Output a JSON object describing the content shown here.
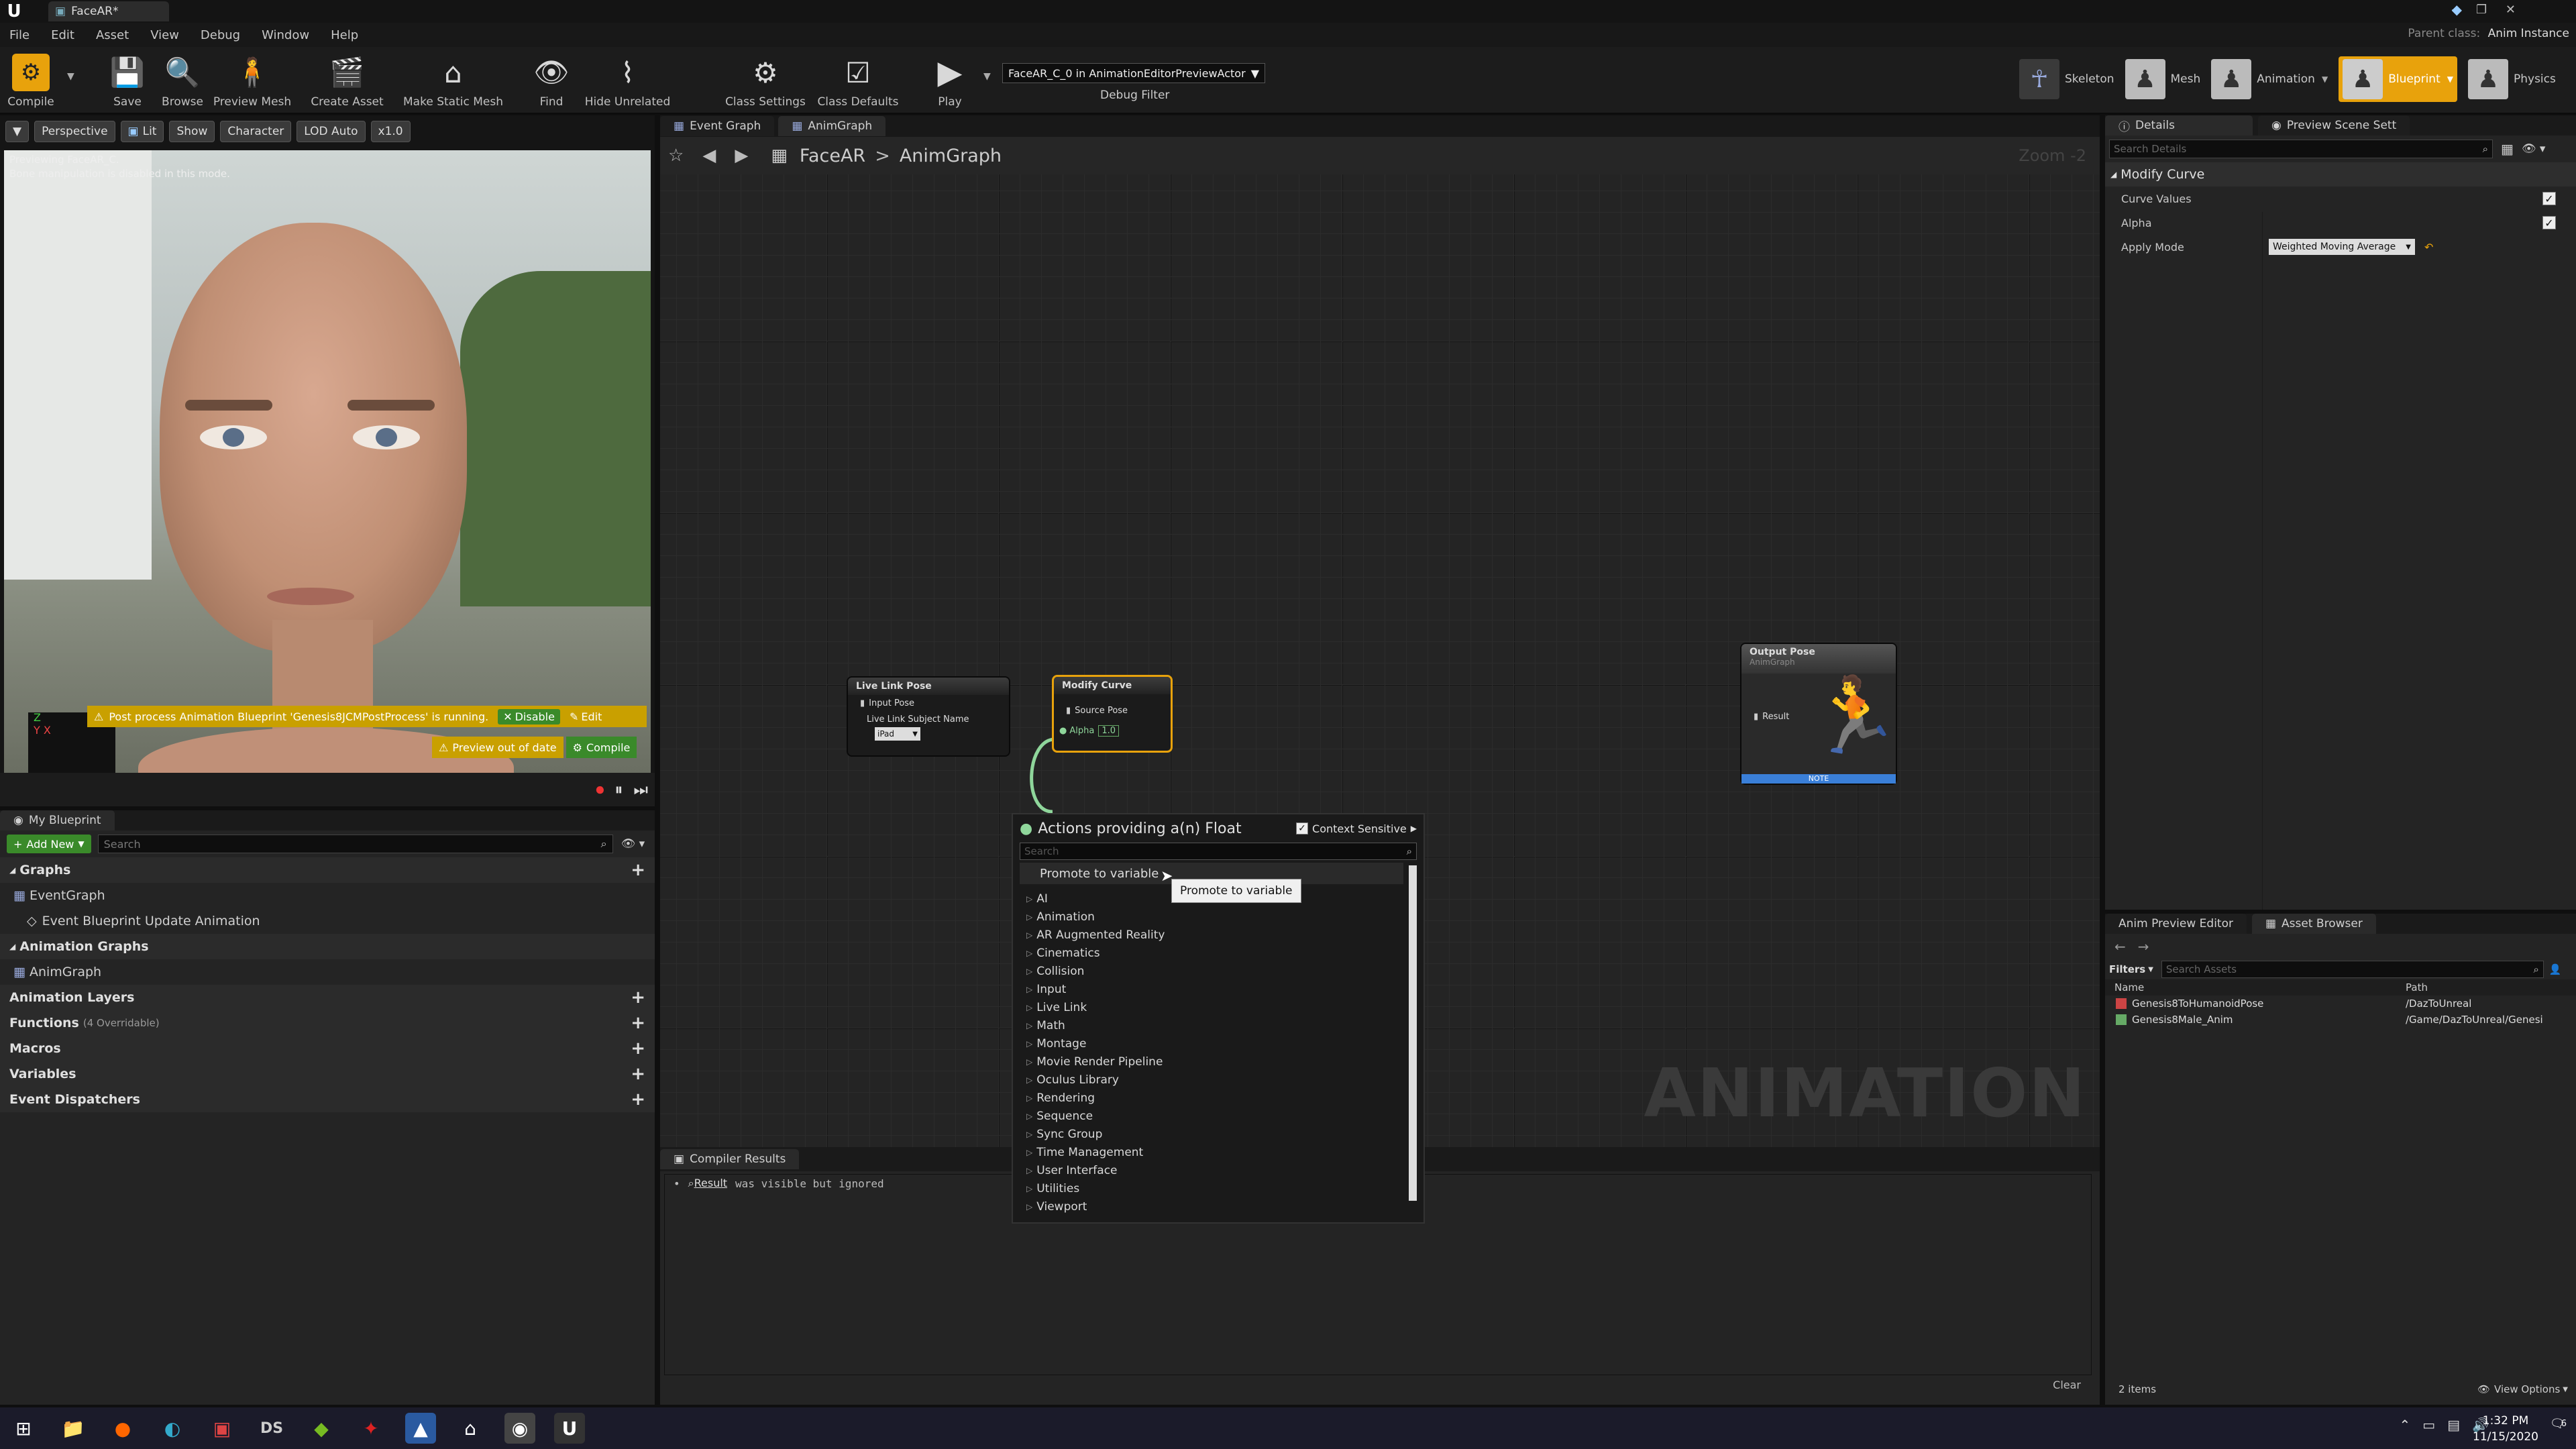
{
  "window": {
    "tab_title": "FaceAR*",
    "parent_class_label": "Parent class:",
    "parent_class_value": "Anim Instance"
  },
  "menu": [
    "File",
    "Edit",
    "Asset",
    "View",
    "Debug",
    "Window",
    "Help"
  ],
  "toolbar": {
    "compile": "Compile",
    "save": "Save",
    "browse": "Browse",
    "preview_mesh": "Preview Mesh",
    "create_asset": "Create Asset",
    "make_static_mesh": "Make Static Mesh",
    "find": "Find",
    "hide_unrelated": "Hide Unrelated",
    "class_settings": "Class Settings",
    "class_defaults": "Class Defaults",
    "play": "Play",
    "debug_select": "FaceAR_C_0 in AnimationEditorPreviewActor",
    "debug_filter": "Debug Filter"
  },
  "modes": {
    "skeleton": "Skeleton",
    "mesh": "Mesh",
    "animation": "Animation",
    "blueprint": "Blueprint",
    "physics": "Physics"
  },
  "viewport": {
    "perspective": "Perspective",
    "lit": "Lit",
    "show": "Show",
    "character": "Character",
    "lod": "LOD Auto",
    "speed": "x1.0",
    "info_line1": "Previewing FaceAR_C.",
    "info_line2": "Bone manipulation is disabled in this mode.",
    "warning": "Post process Animation Blueprint 'Genesis8JCMPostProcess' is running.",
    "disable": "Disable",
    "edit": "Edit",
    "out_of_date": "Preview out of date",
    "compile": "Compile"
  },
  "my_blueprint": {
    "tab": "My Blueprint",
    "add_new": "Add New",
    "search_placeholder": "Search",
    "graphs": "Graphs",
    "event_graph": "EventGraph",
    "event_update": "Event Blueprint Update Animation",
    "anim_graphs": "Animation Graphs",
    "anim_graph": "AnimGraph",
    "anim_layers": "Animation Layers",
    "functions": "Functions",
    "functions_note": "(4 Overridable)",
    "macros": "Macros",
    "variables": "Variables",
    "dispatchers": "Event Dispatchers"
  },
  "graph": {
    "tabs": [
      "Event Graph",
      "AnimGraph"
    ],
    "breadcrumb_root": "FaceAR",
    "breadcrumb_sep": ">",
    "breadcrumb_leaf": "AnimGraph",
    "zoom": "Zoom -2",
    "watermark": "ANIMATION",
    "live_link": {
      "title": "Live Link Pose",
      "input": "Input Pose",
      "subject_label": "Live Link Subject Name",
      "subject_value": "iPad"
    },
    "modify_curve": {
      "title": "Modify Curve",
      "source": "Source Pose",
      "alpha": "Alpha",
      "alpha_value": "1.0"
    },
    "output_pose": {
      "title": "Output Pose",
      "subtitle": "AnimGraph",
      "result": "Result",
      "note": "NOTE"
    }
  },
  "context_menu": {
    "title": "Actions providing a(n) Float",
    "context_sensitive": "Context Sensitive",
    "search_placeholder": "Search",
    "promote": "Promote to variable",
    "tooltip": "Promote to variable",
    "categories": [
      "AI",
      "Animation",
      "AR Augmented Reality",
      "Cinematics",
      "Collision",
      "Input",
      "Live Link",
      "Math",
      "Montage",
      "Movie Render Pipeline",
      "Oculus Library",
      "Rendering",
      "Sequence",
      "Sync Group",
      "Time Management",
      "User Interface",
      "Utilities",
      "Viewport"
    ]
  },
  "compiler": {
    "tab": "Compiler Results",
    "result_label": "Result",
    "result_text": "was visible but ignored",
    "clear": "Clear"
  },
  "details": {
    "tab": "Details",
    "tab2": "Preview Scene Sett",
    "search_placeholder": "Search Details",
    "section": "Modify Curve",
    "curve_values": "Curve Values",
    "alpha": "Alpha",
    "apply_mode": "Apply Mode",
    "apply_mode_value": "Weighted Moving Average"
  },
  "asset_browser": {
    "tab1": "Anim Preview Editor",
    "tab2": "Asset Browser",
    "filters": "Filters",
    "search_placeholder": "Search Assets",
    "col_name": "Name",
    "col_path": "Path",
    "rows": [
      {
        "name": "Genesis8ToHumanoidPose",
        "path": "/DazToUnreal"
      },
      {
        "name": "Genesis8Male_Anim",
        "path": "/Game/DazToUnreal/Genesi"
      }
    ],
    "count": "2 items",
    "view_options": "View Options"
  },
  "taskbar": {
    "time": "1:32 PM",
    "date": "11/15/2020",
    "notifications": "6"
  },
  "colors": {
    "accent_orange": "#e8a20c",
    "add_green": "#3a8a2a",
    "warning_yellow": "#c9a000"
  }
}
